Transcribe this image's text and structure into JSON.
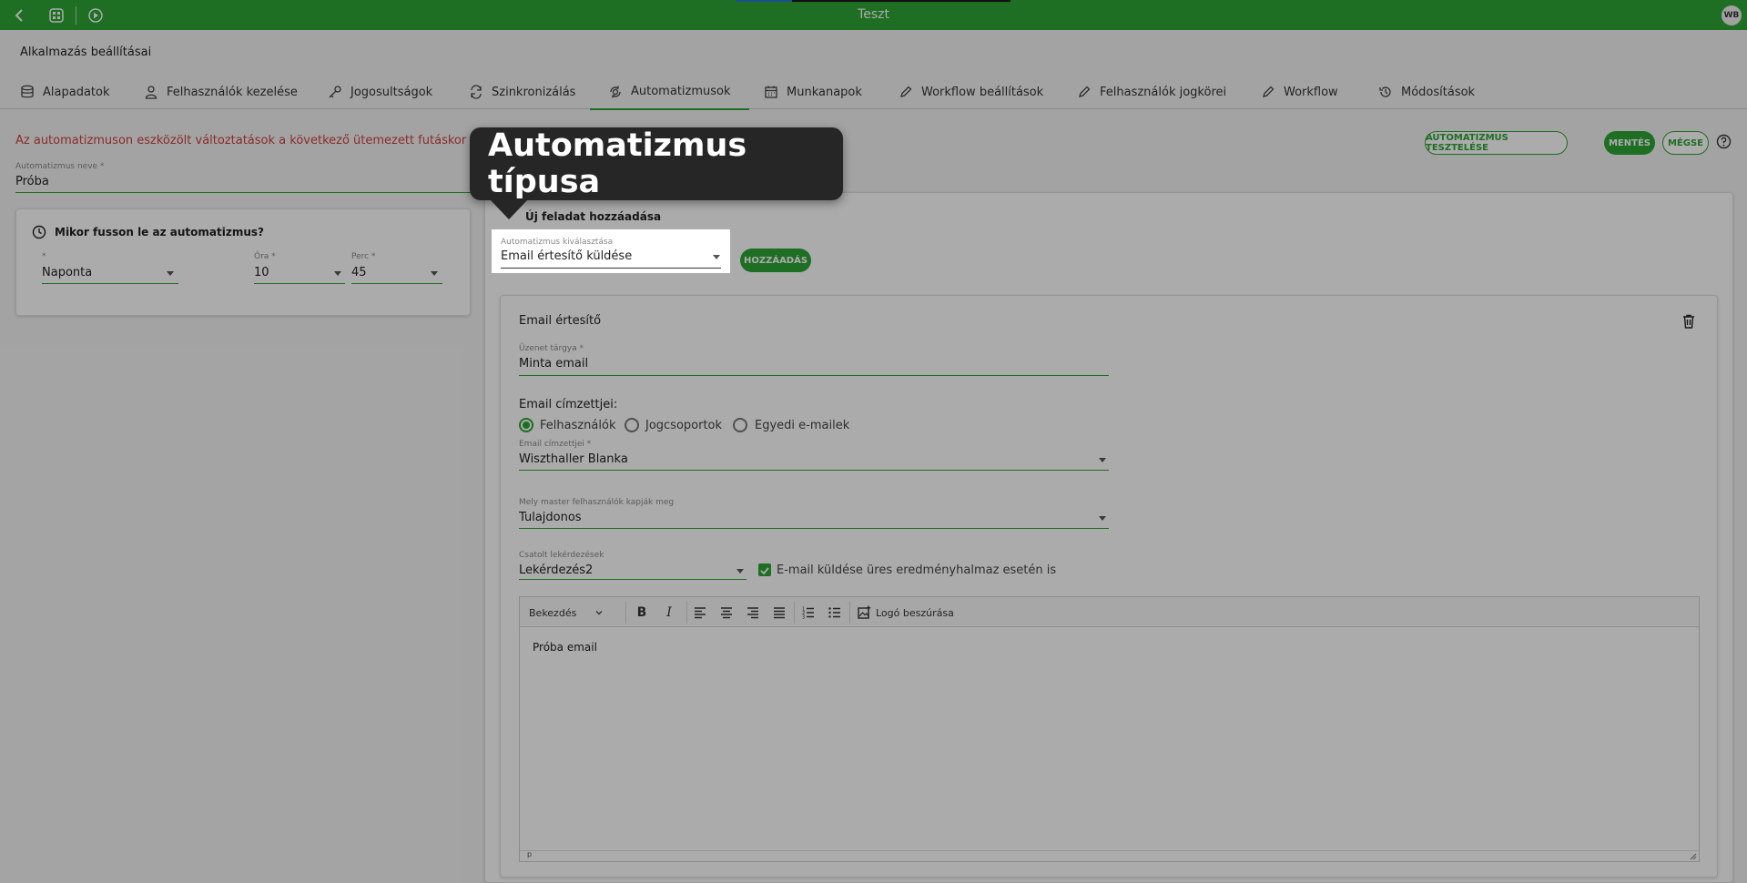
{
  "topbar": {
    "title": "Teszt",
    "avatar": "WB"
  },
  "app_title": "Alkalmazás beállításai",
  "tabs": [
    {
      "label": "Alapadatok",
      "icon": "database-icon"
    },
    {
      "label": "Felhasználók kezelése",
      "icon": "user-icon"
    },
    {
      "label": "Jogosultságok",
      "icon": "key-icon"
    },
    {
      "label": "Szinkronizálás",
      "icon": "sync-icon"
    },
    {
      "label": "Automatizmusok",
      "icon": "automation-icon",
      "active": true
    },
    {
      "label": "Munkanapok",
      "icon": "calendar-icon"
    },
    {
      "label": "Workflow beállítások",
      "icon": "pencil-icon"
    },
    {
      "label": "Felhasználók jogkörei",
      "icon": "pencil-icon"
    },
    {
      "label": "Workflow",
      "icon": "pencil-icon"
    },
    {
      "label": "Módosítások",
      "icon": "history-icon"
    }
  ],
  "warning": "Az automatizmuson eszközölt változtatások a következő ütemezett futáskor lépnek",
  "buttons": {
    "test": "AUTOMATIZMUS TESZTELÉSE",
    "save": "MENTÉS",
    "cancel": "MÉGSE",
    "add": "HOZZÁADÁS"
  },
  "automation_name": {
    "label": "Automatizmus neve *",
    "value": "Próba"
  },
  "schedule": {
    "title": "Mikor fusson le az automatizmus?",
    "frequency": {
      "label": "*",
      "value": "Naponta"
    },
    "hour": {
      "label": "Óra *",
      "value": "10"
    },
    "minute": {
      "label": "Perc *",
      "value": "45"
    }
  },
  "new_task": {
    "title": "Új feladat hozzáadása",
    "select_label": "Automatizmus kiválasztása",
    "select_value": "Email értesítő küldése"
  },
  "email": {
    "title": "Email értesítő",
    "subject": {
      "label": "Üzenet tárgya *",
      "value": "Minta email"
    },
    "recipients_title": "Email címzettjei:",
    "radios": [
      "Felhasználók",
      "Jogcsoportok",
      "Egyedi e-mailek"
    ],
    "recipients": {
      "label": "Email címzettjei *",
      "value": "Wiszthaller Blanka"
    },
    "master": {
      "label": "Mely master felhasználók kapják meg",
      "value": "Tulajdonos"
    },
    "query": {
      "label": "Csatolt lekérdezések",
      "value": "Lekérdezés2"
    },
    "empty_send": "E-mail küldése üres eredményhalmaz esetén is"
  },
  "editor": {
    "paragraph": "Bekezdés",
    "bold": "B",
    "italic": "I",
    "logo": "Logó beszúrása",
    "content": "Próba email",
    "status": "p"
  },
  "tooltip": "Automatizmus típusa",
  "colors": {
    "accent": "#2ea535",
    "warning": "#d04040",
    "tooltip_bg": "#262626"
  }
}
